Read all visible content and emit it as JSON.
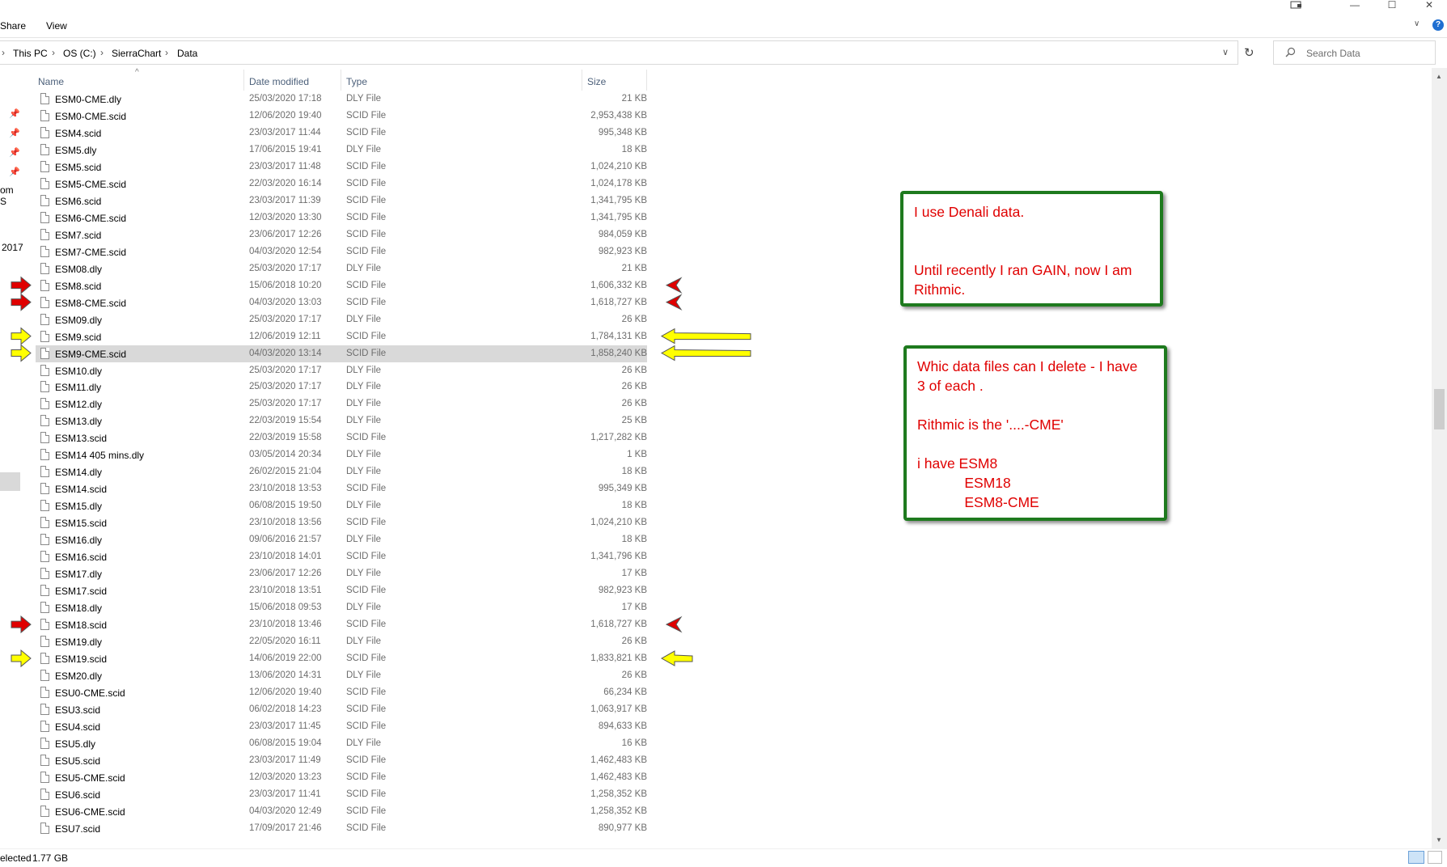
{
  "ribbon": {
    "tabs": [
      "Share",
      "View"
    ]
  },
  "address": {
    "crumbs": [
      "This PC",
      "OS (C:)",
      "SierraChart",
      "Data"
    ]
  },
  "search": {
    "placeholder": "Search Data"
  },
  "nav_pane": {
    "fragments": [
      "om S",
      "2017"
    ]
  },
  "columns": {
    "name": "Name",
    "date": "Date modified",
    "type": "Type",
    "size": "Size"
  },
  "files": [
    {
      "name": "ESM0-CME.dly",
      "date": "25/03/2020 17:18",
      "type": "DLY File",
      "size": "21 KB"
    },
    {
      "name": "ESM0-CME.scid",
      "date": "12/06/2020 19:40",
      "type": "SCID File",
      "size": "2,953,438 KB"
    },
    {
      "name": "ESM4.scid",
      "date": "23/03/2017 11:44",
      "type": "SCID File",
      "size": "995,348 KB"
    },
    {
      "name": "ESM5.dly",
      "date": "17/06/2015 19:41",
      "type": "DLY File",
      "size": "18 KB"
    },
    {
      "name": "ESM5.scid",
      "date": "23/03/2017 11:48",
      "type": "SCID File",
      "size": "1,024,210 KB"
    },
    {
      "name": "ESM5-CME.scid",
      "date": "22/03/2020 16:14",
      "type": "SCID File",
      "size": "1,024,178 KB"
    },
    {
      "name": "ESM6.scid",
      "date": "23/03/2017 11:39",
      "type": "SCID File",
      "size": "1,341,795 KB"
    },
    {
      "name": "ESM6-CME.scid",
      "date": "12/03/2020 13:30",
      "type": "SCID File",
      "size": "1,341,795 KB"
    },
    {
      "name": "ESM7.scid",
      "date": "23/06/2017 12:26",
      "type": "SCID File",
      "size": "984,059 KB"
    },
    {
      "name": "ESM7-CME.scid",
      "date": "04/03/2020 12:54",
      "type": "SCID File",
      "size": "982,923 KB"
    },
    {
      "name": "ESM08.dly",
      "date": "25/03/2020 17:17",
      "type": "DLY File",
      "size": "21 KB"
    },
    {
      "name": "ESM8.scid",
      "date": "15/06/2018 10:20",
      "type": "SCID File",
      "size": "1,606,332 KB"
    },
    {
      "name": "ESM8-CME.scid",
      "date": "04/03/2020 13:03",
      "type": "SCID File",
      "size": "1,618,727 KB"
    },
    {
      "name": "ESM09.dly",
      "date": "25/03/2020 17:17",
      "type": "DLY File",
      "size": "26 KB"
    },
    {
      "name": "ESM9.scid",
      "date": "12/06/2019 12:11",
      "type": "SCID File",
      "size": "1,784,131 KB"
    },
    {
      "name": "ESM9-CME.scid",
      "date": "04/03/2020 13:14",
      "type": "SCID File",
      "size": "1,858,240 KB"
    },
    {
      "name": "ESM10.dly",
      "date": "25/03/2020 17:17",
      "type": "DLY File",
      "size": "26 KB"
    },
    {
      "name": "ESM11.dly",
      "date": "25/03/2020 17:17",
      "type": "DLY File",
      "size": "26 KB"
    },
    {
      "name": "ESM12.dly",
      "date": "25/03/2020 17:17",
      "type": "DLY File",
      "size": "26 KB"
    },
    {
      "name": "ESM13.dly",
      "date": "22/03/2019 15:54",
      "type": "DLY File",
      "size": "25 KB"
    },
    {
      "name": "ESM13.scid",
      "date": "22/03/2019 15:58",
      "type": "SCID File",
      "size": "1,217,282 KB"
    },
    {
      "name": "ESM14 405 mins.dly",
      "date": "03/05/2014 20:34",
      "type": "DLY File",
      "size": "1 KB"
    },
    {
      "name": "ESM14.dly",
      "date": "26/02/2015 21:04",
      "type": "DLY File",
      "size": "18 KB"
    },
    {
      "name": "ESM14.scid",
      "date": "23/10/2018 13:53",
      "type": "SCID File",
      "size": "995,349 KB"
    },
    {
      "name": "ESM15.dly",
      "date": "06/08/2015 19:50",
      "type": "DLY File",
      "size": "18 KB"
    },
    {
      "name": "ESM15.scid",
      "date": "23/10/2018 13:56",
      "type": "SCID File",
      "size": "1,024,210 KB"
    },
    {
      "name": "ESM16.dly",
      "date": "09/06/2016 21:57",
      "type": "DLY File",
      "size": "18 KB"
    },
    {
      "name": "ESM16.scid",
      "date": "23/10/2018 14:01",
      "type": "SCID File",
      "size": "1,341,796 KB"
    },
    {
      "name": "ESM17.dly",
      "date": "23/06/2017 12:26",
      "type": "DLY File",
      "size": "17 KB"
    },
    {
      "name": "ESM17.scid",
      "date": "23/10/2018 13:51",
      "type": "SCID File",
      "size": "982,923 KB"
    },
    {
      "name": "ESM18.dly",
      "date": "15/06/2018 09:53",
      "type": "DLY File",
      "size": "17 KB"
    },
    {
      "name": "ESM18.scid",
      "date": "23/10/2018 13:46",
      "type": "SCID File",
      "size": "1,618,727 KB"
    },
    {
      "name": "ESM19.dly",
      "date": "22/05/2020 16:11",
      "type": "DLY File",
      "size": "26 KB"
    },
    {
      "name": "ESM19.scid",
      "date": "14/06/2019 22:00",
      "type": "SCID File",
      "size": "1,833,821 KB"
    },
    {
      "name": "ESM20.dly",
      "date": "13/06/2020 14:31",
      "type": "DLY File",
      "size": "26 KB"
    },
    {
      "name": "ESU0-CME.scid",
      "date": "12/06/2020 19:40",
      "type": "SCID File",
      "size": "66,234 KB"
    },
    {
      "name": "ESU3.scid",
      "date": "06/02/2018 14:23",
      "type": "SCID File",
      "size": "1,063,917 KB"
    },
    {
      "name": "ESU4.scid",
      "date": "23/03/2017 11:45",
      "type": "SCID File",
      "size": "894,633 KB"
    },
    {
      "name": "ESU5.dly",
      "date": "06/08/2015 19:04",
      "type": "DLY File",
      "size": "16 KB"
    },
    {
      "name": "ESU5.scid",
      "date": "23/03/2017 11:49",
      "type": "SCID File",
      "size": "1,462,483 KB"
    },
    {
      "name": "ESU5-CME.scid",
      "date": "12/03/2020 13:23",
      "type": "SCID File",
      "size": "1,462,483 KB"
    },
    {
      "name": "ESU6.scid",
      "date": "23/03/2017 11:41",
      "type": "SCID File",
      "size": "1,258,352 KB"
    },
    {
      "name": "ESU6-CME.scid",
      "date": "04/03/2020 12:49",
      "type": "SCID File",
      "size": "1,258,352 KB"
    },
    {
      "name": "ESU7.scid",
      "date": "17/09/2017 21:46",
      "type": "SCID File",
      "size": "890,977 KB"
    }
  ],
  "selected_index": 15,
  "arrows": {
    "red": {
      "color": "#e00000",
      "rows_left": [
        11,
        12,
        31
      ],
      "rows_right": [
        11,
        12,
        31
      ]
    },
    "yellow": {
      "color": "#ffff00",
      "rows_left": [
        14,
        15,
        33
      ],
      "rows_right": [
        14,
        15,
        33
      ]
    }
  },
  "notes": {
    "note1": "I use Denali data.\n\n\nUntil recently I ran GAIN, now I am\nRithmic.",
    "note2": "Whic data files can I delete - I have\n3 of each .\n\nRithmic is the '....-CME'\n\ni have ESM8\n            ESM18\n            ESM8-CME"
  },
  "status": {
    "left": "elected",
    "size": "1.77 GB"
  }
}
